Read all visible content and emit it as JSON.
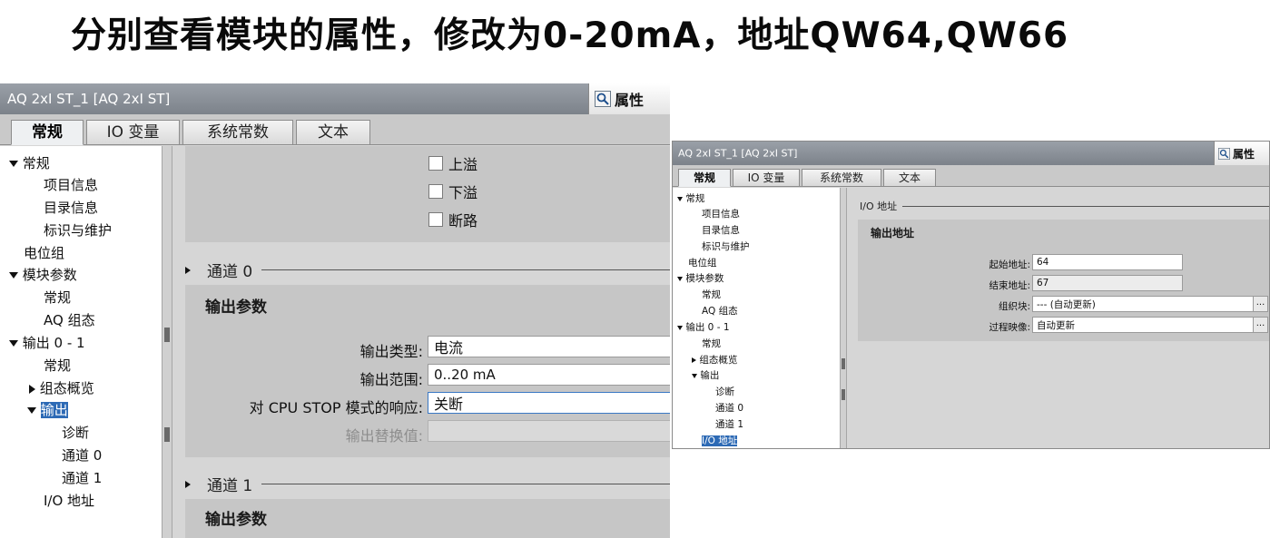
{
  "headline": "分别查看模块的属性，修改为0-20mA，地址QW64,QW66",
  "left": {
    "title": "AQ 2xI ST_1 [AQ 2xI ST]",
    "properties_label": "属性",
    "tabs": [
      "常规",
      "IO 变量",
      "系统常数",
      "文本"
    ],
    "tree": [
      "常规",
      "项目信息",
      "目录信息",
      "标识与维护",
      "电位组",
      "模块参数",
      "常规",
      "AQ 组态",
      "输出 0 - 1",
      "常规",
      "组态概览",
      "输出",
      "诊断",
      "通道 0",
      "通道 1",
      "I/O 地址"
    ],
    "checkboxes": [
      "上溢",
      "下溢",
      "断路"
    ],
    "channel0": "通道 0",
    "channel1": "通道 1",
    "output_params": "输出参数",
    "output_params2": "输出参数",
    "fields": {
      "type_label": "输出类型:",
      "type_value": "电流",
      "range_label": "输出范围:",
      "range_value": "0..20 mA",
      "stop_label": "对 CPU STOP 模式的响应:",
      "stop_value": "关断",
      "subst_label": "输出替换值:"
    }
  },
  "right": {
    "title": "AQ 2xI ST_1 [AQ 2xI ST]",
    "properties_label": "属性",
    "tabs": [
      "常规",
      "IO 变量",
      "系统常数",
      "文本"
    ],
    "tree": [
      "常规",
      "项目信息",
      "目录信息",
      "标识与维护",
      "电位组",
      "模块参数",
      "常规",
      "AQ 组态",
      "输出 0 - 1",
      "常规",
      "组态概览",
      "输出",
      "诊断",
      "通道 0",
      "通道 1",
      "I/O 地址"
    ],
    "io_section": "I/O 地址",
    "output_address": "输出地址",
    "fields": {
      "start_label": "起始地址:",
      "start_value": "64",
      "end_label": "结束地址:",
      "end_value": "67",
      "ob_label": "组织块:",
      "ob_value": "--- (自动更新)",
      "pi_label": "过程映像:",
      "pi_value": "自动更新",
      "browse": "..."
    }
  },
  "icons": {
    "properties": "magnifier-icon",
    "expand": "triangle-down-icon",
    "collapse": "triangle-right-icon"
  },
  "colors": {
    "selection": "#2d6ab5",
    "titlebar": "#8a9098",
    "panel": "#d6d6d6"
  }
}
